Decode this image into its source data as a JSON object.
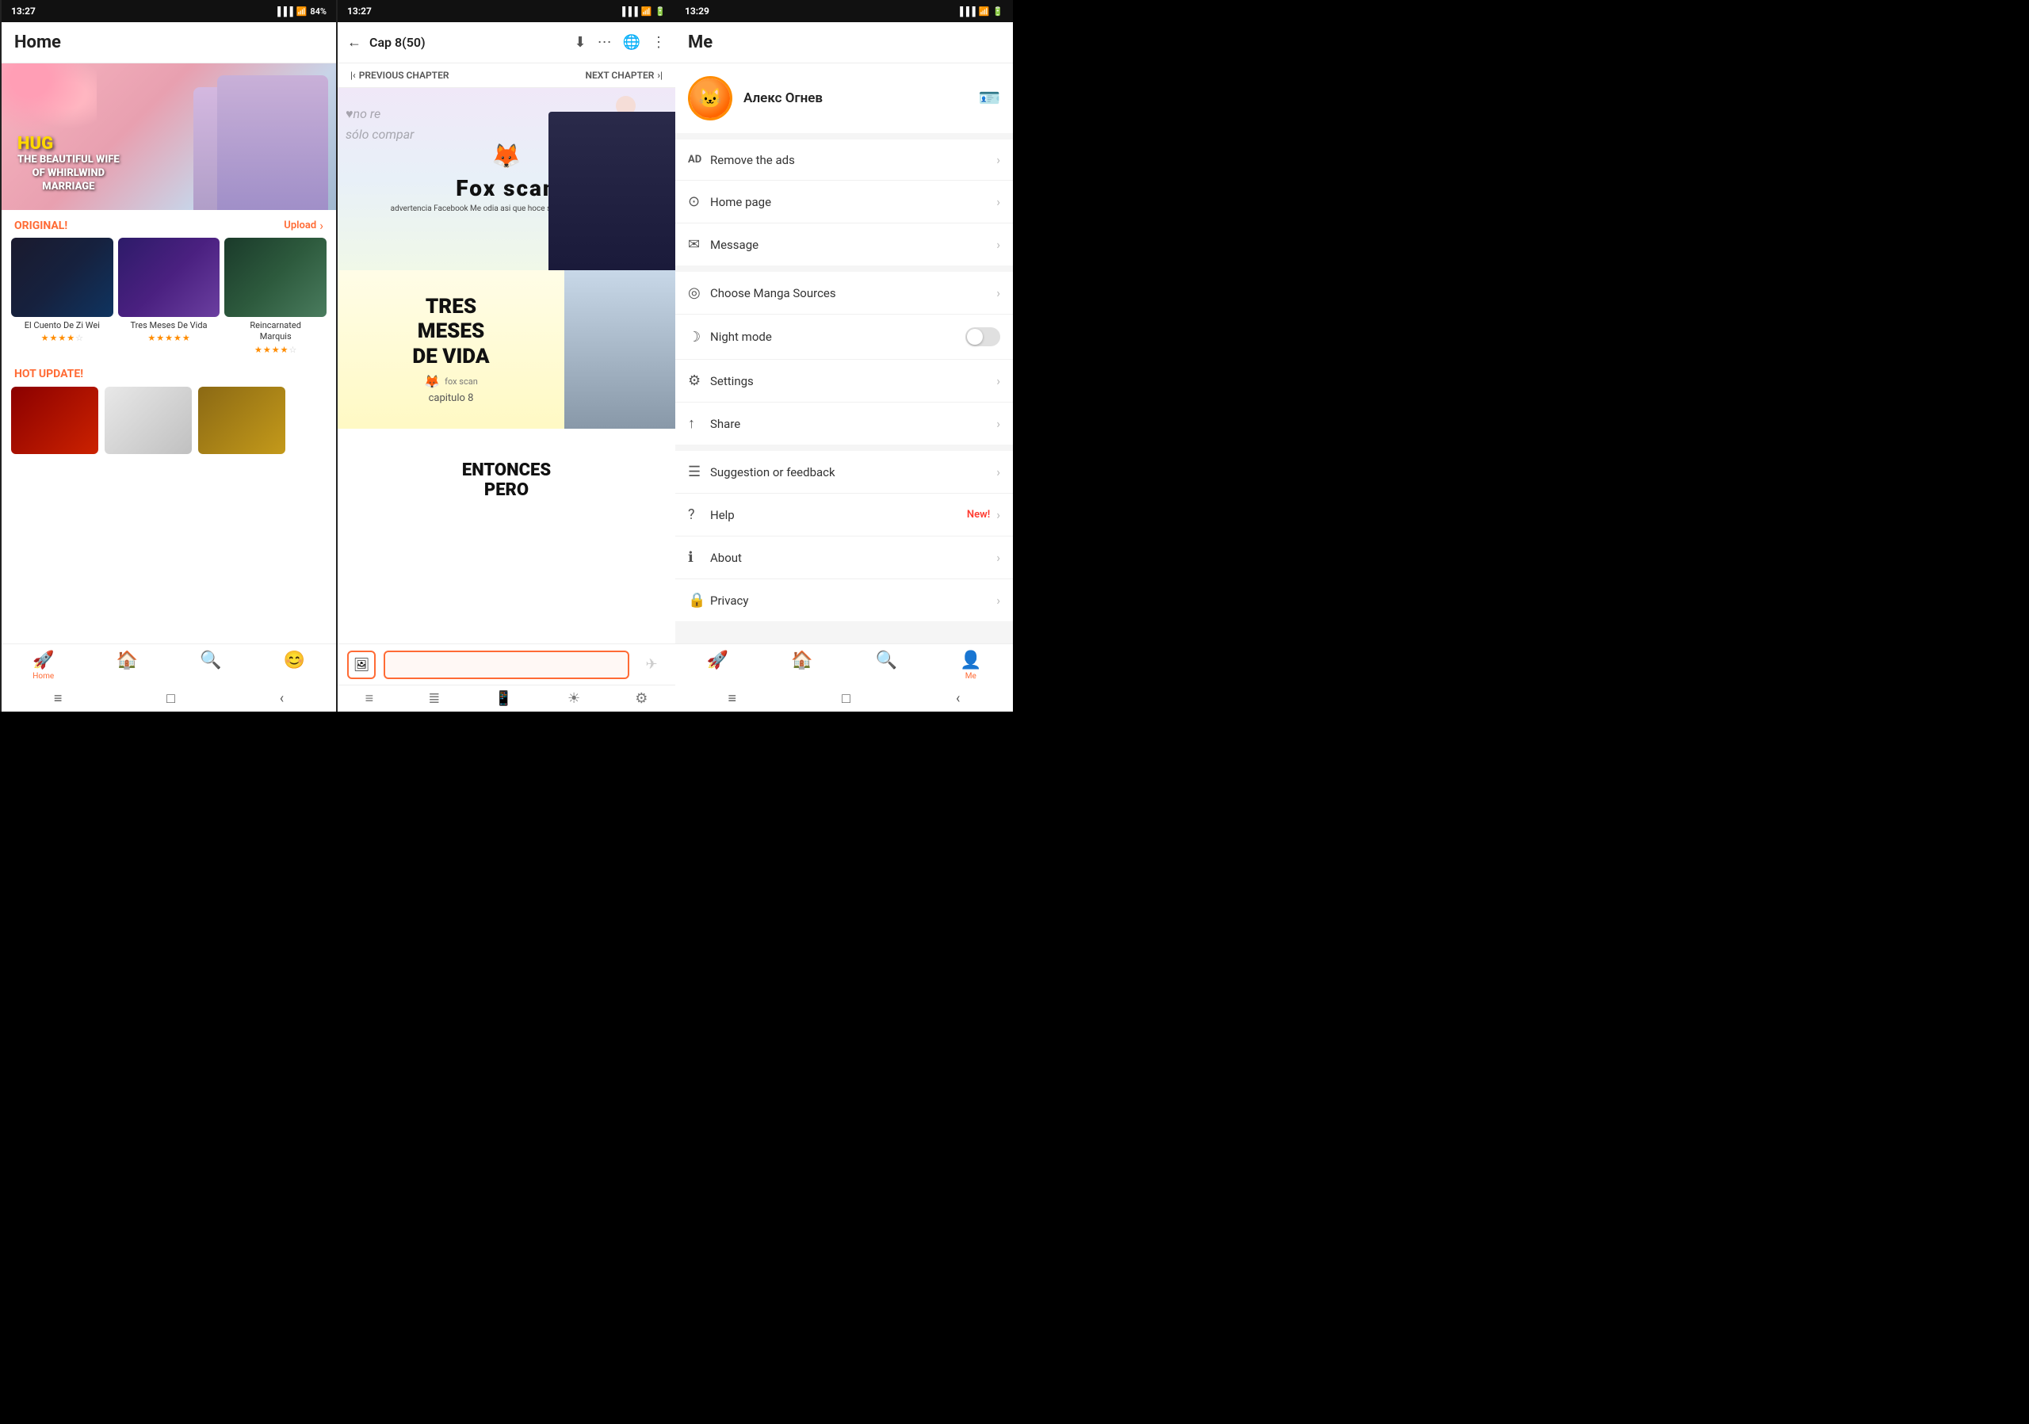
{
  "phone1": {
    "status": {
      "time": "13:27",
      "battery": "84%"
    },
    "header": {
      "title": "Home"
    },
    "banner": {
      "hug": "HUG",
      "subtitle": "THE BEAUTIFUL WIFE\nOF WHIRLWIND\nMARRIAGE"
    },
    "original_section": {
      "label": "ORIGINAL!",
      "upload": "Upload",
      "arrow": "›"
    },
    "manga_items": [
      {
        "title": "El Cuento De Zi Wei",
        "stars": 3.5
      },
      {
        "title": "Tres Meses De Vida",
        "stars": 5
      },
      {
        "title": "Reincarnated Marquis",
        "stars": 3.5
      }
    ],
    "hot_update": {
      "label": "HOT UPDATE!"
    },
    "nav": {
      "items": [
        {
          "icon": "🚀",
          "label": "Home",
          "active": true
        },
        {
          "icon": "🏠",
          "label": "",
          "active": false
        },
        {
          "icon": "🔍",
          "label": "",
          "active": false
        },
        {
          "icon": "😊",
          "label": "",
          "active": false
        }
      ]
    }
  },
  "phone2": {
    "status": {
      "time": "13:27"
    },
    "header": {
      "title": "Cap 8(50)",
      "back_arrow": "←"
    },
    "chapter_nav": {
      "previous": "PREVIOUS CHAPTER",
      "next": "NEXT CHAPTER"
    },
    "pages": [
      {
        "type": "foxscan",
        "watermark_line1": "♥no re",
        "watermark_line2": "sólo compar",
        "logo": "Fox scan",
        "disclaimer": "advertencia Facebook Me odia asi que hoce si me van a encontrar"
      },
      {
        "type": "tresmeses",
        "line1": "TRES",
        "line2": "MESES",
        "line3": "DE VIDA",
        "cap": "capitulo 8"
      },
      {
        "type": "entonces",
        "text": "ENTONCES\nPERO"
      }
    ],
    "input_placeholder": "",
    "reader_nav": [
      "≡",
      "≣",
      "📱",
      "☀",
      "⚙"
    ]
  },
  "phone3": {
    "status": {
      "time": "13:29"
    },
    "header": {
      "title": "Me"
    },
    "profile": {
      "username": "Алекс Огнев",
      "avatar_emoji": "🐱"
    },
    "menu_sections": [
      {
        "items": [
          {
            "icon": "AD",
            "icon_type": "text",
            "label": "Remove the ads",
            "type": "arrow"
          },
          {
            "icon": "⊙",
            "label": "Home page",
            "type": "arrow"
          },
          {
            "icon": "✉",
            "label": "Message",
            "type": "arrow"
          }
        ]
      },
      {
        "items": [
          {
            "icon": "◎",
            "label": "Choose Manga Sources",
            "type": "arrow"
          },
          {
            "icon": "☽",
            "label": "Night mode",
            "type": "toggle"
          },
          {
            "icon": "⚙",
            "label": "Settings",
            "type": "arrow"
          },
          {
            "icon": "↑",
            "label": "Share",
            "type": "arrow"
          }
        ]
      },
      {
        "items": [
          {
            "icon": "☰",
            "label": "Suggestion or feedback",
            "type": "arrow"
          },
          {
            "icon": "?",
            "label": "Help",
            "type": "arrow",
            "badge": "New!"
          },
          {
            "icon": "ℹ",
            "label": "About",
            "type": "arrow"
          },
          {
            "icon": "🔒",
            "label": "Privacy",
            "type": "arrow"
          }
        ]
      }
    ],
    "nav": {
      "items": [
        {
          "icon": "🚀",
          "label": "",
          "active": false
        },
        {
          "icon": "🏠",
          "label": "",
          "active": false
        },
        {
          "icon": "🔍",
          "label": "",
          "active": false
        },
        {
          "icon": "👤",
          "label": "Me",
          "active": true
        }
      ]
    }
  }
}
